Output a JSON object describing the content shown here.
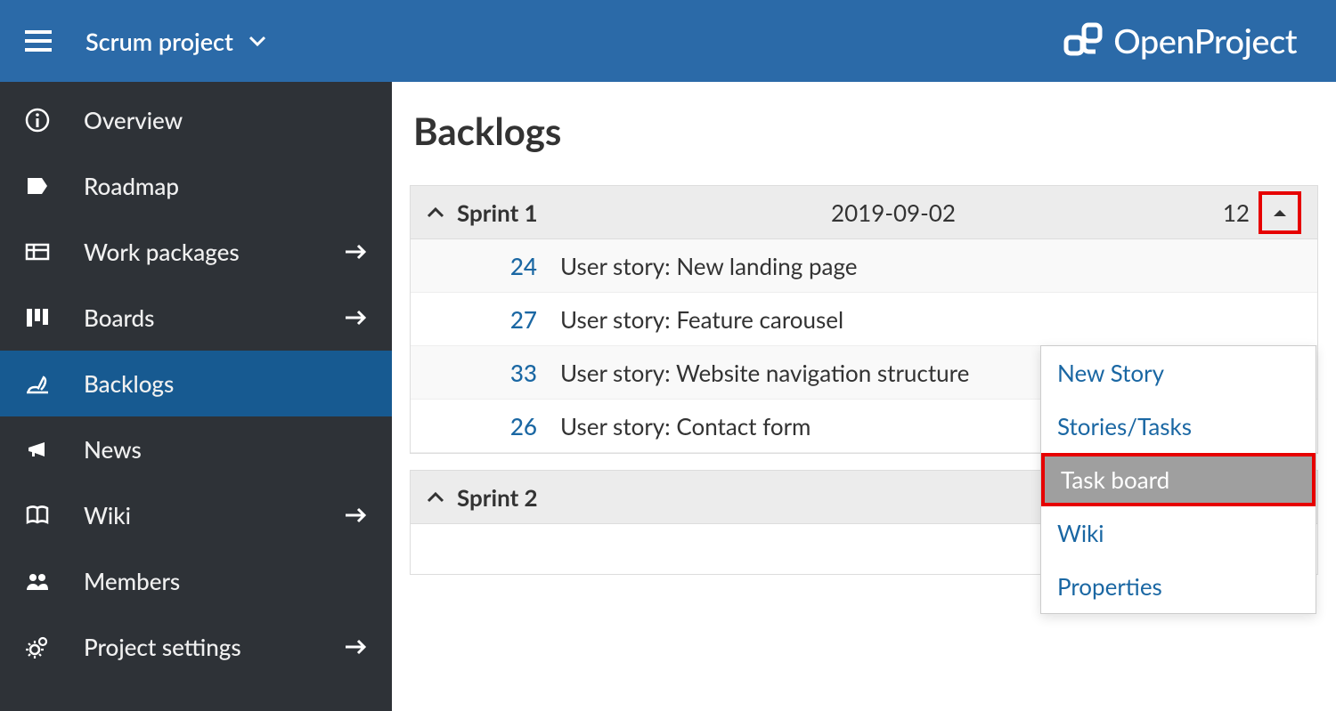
{
  "header": {
    "project_name": "Scrum project",
    "brand": "OpenProject"
  },
  "sidebar": {
    "items": [
      {
        "label": "Overview",
        "icon": "info-icon",
        "has_arrow": false,
        "active": false
      },
      {
        "label": "Roadmap",
        "icon": "tag-icon",
        "has_arrow": false,
        "active": false
      },
      {
        "label": "Work packages",
        "icon": "grid-icon",
        "has_arrow": true,
        "active": false
      },
      {
        "label": "Boards",
        "icon": "columns-icon",
        "has_arrow": true,
        "active": false
      },
      {
        "label": "Backlogs",
        "icon": "backlogs-icon",
        "has_arrow": false,
        "active": true
      },
      {
        "label": "News",
        "icon": "megaphone-icon",
        "has_arrow": false,
        "active": false
      },
      {
        "label": "Wiki",
        "icon": "book-icon",
        "has_arrow": true,
        "active": false
      },
      {
        "label": "Members",
        "icon": "members-icon",
        "has_arrow": false,
        "active": false
      },
      {
        "label": "Project settings",
        "icon": "gears-icon",
        "has_arrow": true,
        "active": false
      }
    ]
  },
  "page": {
    "title": "Backlogs"
  },
  "sprints": [
    {
      "name": "Sprint 1",
      "date": "2019-09-02",
      "count": "12",
      "expanded": true,
      "menu_open": true,
      "stories": [
        {
          "id": "24",
          "title": "User story: New landing page"
        },
        {
          "id": "27",
          "title": "User story: Feature carousel"
        },
        {
          "id": "33",
          "title": "User story: Website navigation structure"
        },
        {
          "id": "26",
          "title": "User story: Contact form"
        }
      ]
    },
    {
      "name": "Sprint 2",
      "date": "",
      "count": "",
      "expanded": true,
      "menu_open": false,
      "stories": []
    }
  ],
  "dropdown": {
    "items": [
      {
        "label": "New Story",
        "hover": false,
        "highlight": false
      },
      {
        "label": "Stories/Tasks",
        "hover": false,
        "highlight": false
      },
      {
        "label": "Task board",
        "hover": true,
        "highlight": true
      },
      {
        "label": "Wiki",
        "hover": false,
        "highlight": false
      },
      {
        "label": "Properties",
        "hover": false,
        "highlight": false
      }
    ]
  }
}
